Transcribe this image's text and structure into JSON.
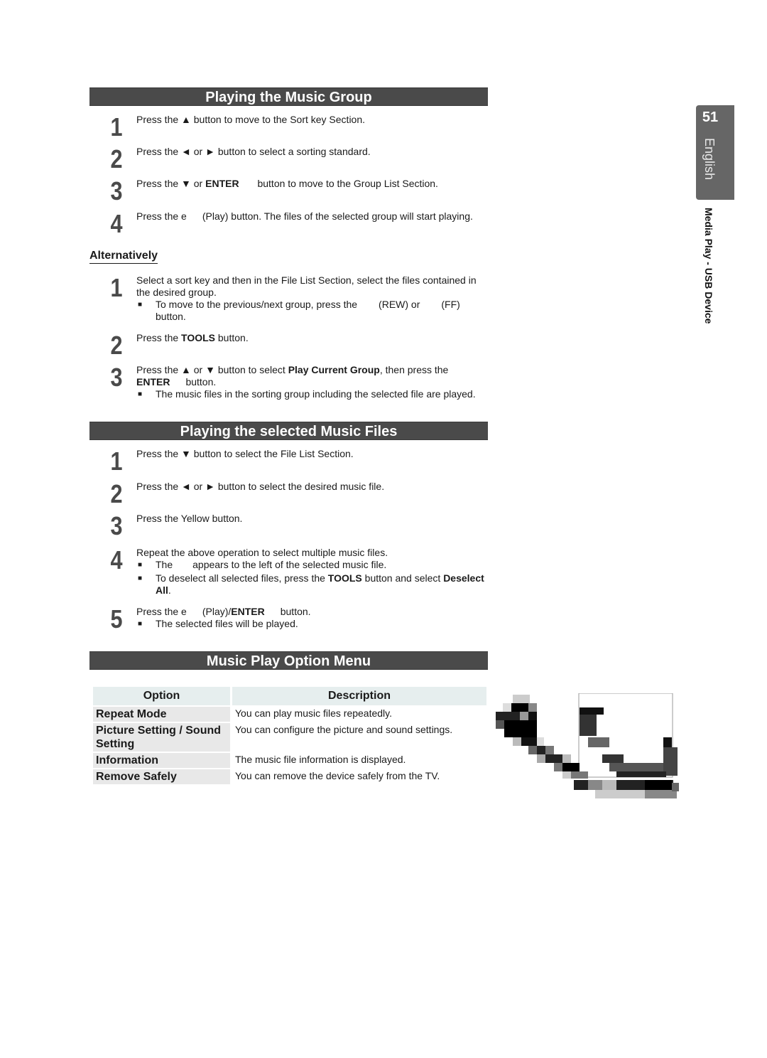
{
  "side_tab": {
    "page_number": "51",
    "language": "English",
    "chapter": "Media Play - USB Device"
  },
  "section1": {
    "title": "Playing the Music Group",
    "steps": [
      {
        "n": "1",
        "a": "Press the ▲ button to move to the Sort key Section."
      },
      {
        "n": "2",
        "a": "Press the ◄ or ► button to select a sorting standard."
      },
      {
        "n": "3",
        "a": "Press the ▼ or ",
        "b": "ENTER",
        "c": " button to move to the Group List Section."
      },
      {
        "n": "4",
        "a": "Press the e",
        "c": "(Play) button. The files of the selected group will start playing."
      }
    ]
  },
  "alternatively": {
    "heading": "Alternatively",
    "steps": [
      {
        "n": "1",
        "a": "Select a sort key and then in the File List Section, select the files contained in the desired group.",
        "note": "To move to the previous/next group, press the",
        "note_rew": "(REW) or",
        "note_ff": "(FF)",
        "note_end": "button."
      },
      {
        "n": "2",
        "a": "Press the ",
        "b": "TOOLS",
        "c": " button."
      },
      {
        "n": "3",
        "a": "Press the ▲ or ▼ button to select ",
        "b": "Play Current Group",
        "c": ", then press the",
        "b2": "ENTER",
        "c2": "button.",
        "note": "The music files in the sorting group including the selected file are played."
      }
    ]
  },
  "section2": {
    "title": "Playing the selected Music Files",
    "steps": [
      {
        "n": "1",
        "a": "Press the ▼ button to select the File List Section."
      },
      {
        "n": "2",
        "a": "Press the ◄ or ► button to select the desired music file."
      },
      {
        "n": "3",
        "a": "Press the Yellow button."
      },
      {
        "n": "4",
        "a": "Repeat the above operation to select multiple music files.",
        "note1a": "The",
        "note1b": "appears to the left of the selected music file.",
        "note2a": "To deselect all selected files, press the ",
        "note2b": "TOOLS",
        "note2c": " button and select ",
        "note2d": "Deselect All",
        "note2e": "."
      },
      {
        "n": "5",
        "a": "Press the e",
        "c": "(Play)/",
        "b": "ENTER",
        "d": "button.",
        "note": "The selected files will be played."
      }
    ]
  },
  "section3": {
    "title": "Music Play Option Menu",
    "table": {
      "headers": [
        "Option",
        "Description"
      ],
      "rows": [
        {
          "option": "Repeat Mode",
          "description": "You can play music files repeatedly."
        },
        {
          "option": "Picture Setting / Sound Setting",
          "description": "You can configure the picture and sound settings."
        },
        {
          "option": "Information",
          "description": "The music file information is displayed."
        },
        {
          "option": "Remove Safely",
          "description": "You can remove the device safely from the TV."
        }
      ]
    }
  },
  "square_bullet": "■"
}
